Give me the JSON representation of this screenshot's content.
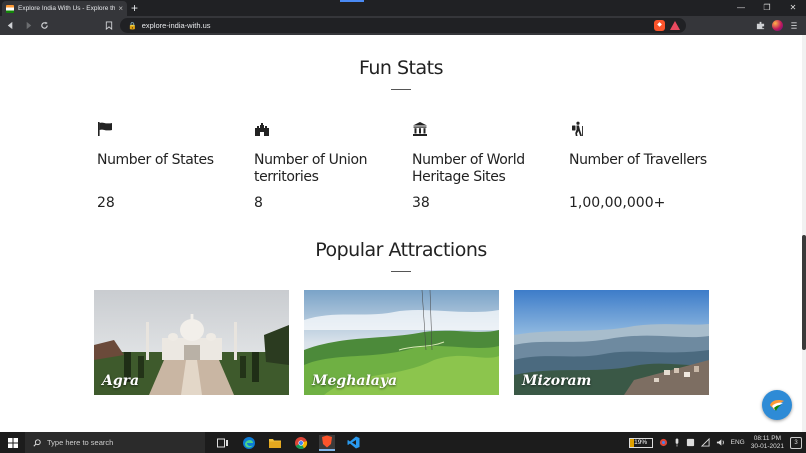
{
  "browser": {
    "tab_title": "Explore India With Us - Explore the",
    "tab_close": "×",
    "new_tab": "+",
    "url": "explore-india-with.us",
    "window_controls": [
      "—",
      "❐",
      "✕"
    ]
  },
  "fun_stats": {
    "heading": "Fun Stats",
    "items": [
      {
        "icon": "flag-icon",
        "label": "Number of States",
        "value": "28"
      },
      {
        "icon": "fort-icon",
        "label": "Number of Union territories",
        "value": "8"
      },
      {
        "icon": "monument-icon",
        "label": "Number of World Heritage Sites",
        "value": "38"
      },
      {
        "icon": "hiker-icon",
        "label": "Number of Travellers",
        "value": "1,00,00,000+"
      }
    ]
  },
  "attractions": {
    "heading": "Popular Attractions",
    "cards": [
      {
        "caption": "Agra"
      },
      {
        "caption": "Meghalaya"
      },
      {
        "caption": "Mizoram"
      }
    ]
  },
  "taskbar": {
    "search_placeholder": "Type here to search",
    "battery": "19%",
    "battery_level": 0.19,
    "language": "ENG",
    "time": "08:11 PM",
    "date": "30-01-2021",
    "notifications": "3"
  }
}
